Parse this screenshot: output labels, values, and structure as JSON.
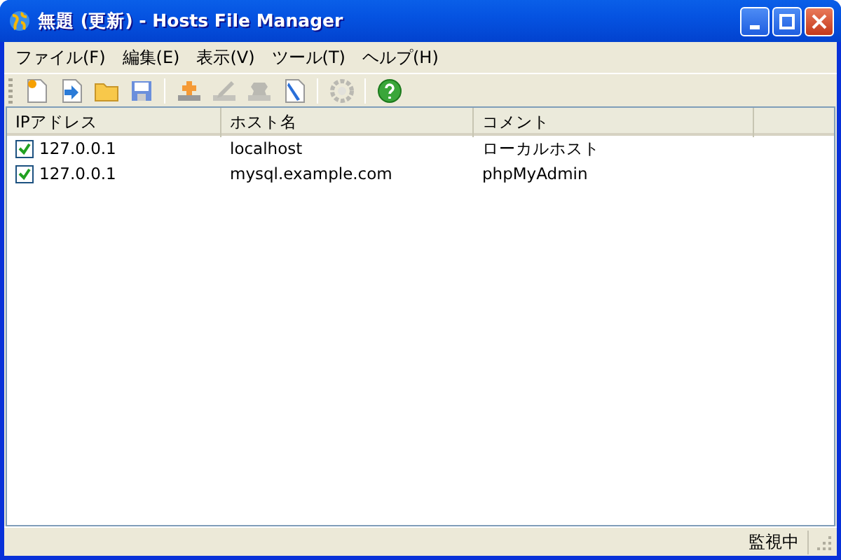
{
  "window": {
    "title": "無題 (更新) - Hosts File Manager"
  },
  "menu": [
    "ファイル(F)",
    "編集(E)",
    "表示(V)",
    "ツール(T)",
    "ヘルプ(H)"
  ],
  "toolbar": [
    {
      "kind": "new",
      "disabled": false
    },
    {
      "kind": "import",
      "disabled": false
    },
    {
      "kind": "open",
      "disabled": false
    },
    {
      "kind": "save",
      "disabled": false
    },
    {
      "kind": "separator"
    },
    {
      "kind": "add",
      "disabled": false
    },
    {
      "kind": "edit",
      "disabled": true
    },
    {
      "kind": "delete",
      "disabled": true
    },
    {
      "kind": "editfile",
      "disabled": false
    },
    {
      "kind": "separator"
    },
    {
      "kind": "settings",
      "disabled": true
    },
    {
      "kind": "separator"
    },
    {
      "kind": "help",
      "disabled": false
    }
  ],
  "table": {
    "columns": [
      "IPアドレス",
      "ホスト名",
      "コメント"
    ],
    "rows": [
      {
        "checked": true,
        "cells": [
          "127.0.0.1",
          "localhost",
          "ローカルホスト"
        ]
      },
      {
        "checked": true,
        "cells": [
          "127.0.0.1",
          "mysql.example.com",
          "phpMyAdmin"
        ]
      }
    ]
  },
  "status_bar": {
    "text": "監視中"
  }
}
